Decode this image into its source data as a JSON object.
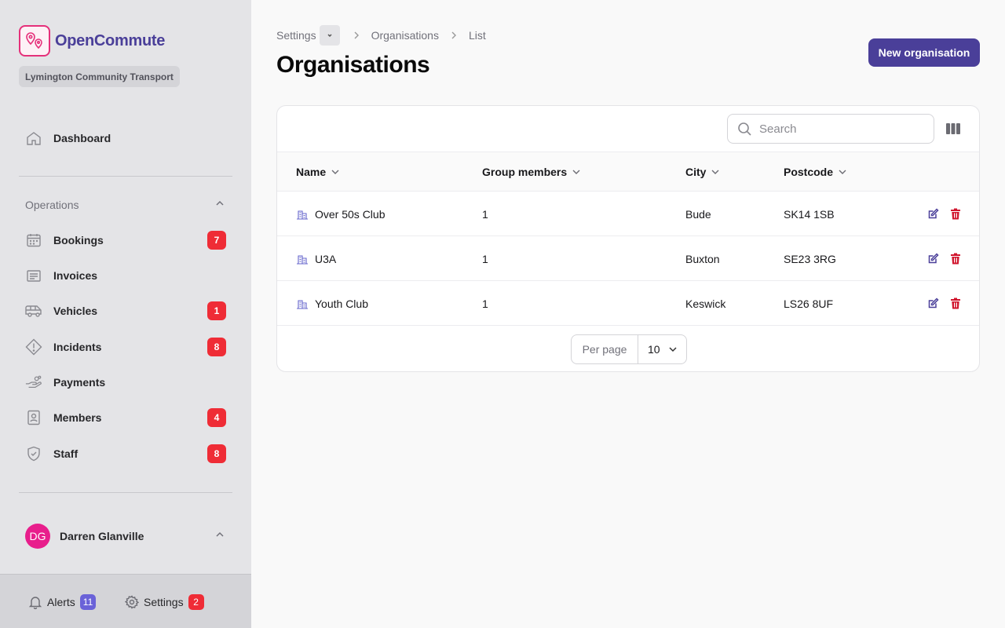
{
  "app": {
    "name": "OpenCommute",
    "organisation": "Lymington Community Transport",
    "brand_color": "#4a3f99",
    "logo_color": "#e5307a"
  },
  "sidebar": {
    "dashboard": {
      "label": "Dashboard",
      "icon": "home-icon"
    },
    "group_label": "Operations",
    "items": [
      {
        "label": "Bookings",
        "icon": "calendar-icon",
        "badge": "7"
      },
      {
        "label": "Invoices",
        "icon": "receipt-icon",
        "badge": null
      },
      {
        "label": "Vehicles",
        "icon": "van-icon",
        "badge": "1"
      },
      {
        "label": "Incidents",
        "icon": "warning-icon",
        "badge": "8"
      },
      {
        "label": "Payments",
        "icon": "hand-coins-icon",
        "badge": null
      },
      {
        "label": "Members",
        "icon": "id-badge-icon",
        "badge": "4"
      },
      {
        "label": "Staff",
        "icon": "shield-check-icon",
        "badge": "8"
      }
    ],
    "user": {
      "initials": "DG",
      "name": "Darren Glanville"
    },
    "footer": {
      "alerts_label": "Alerts",
      "alerts_count": "11",
      "settings_label": "Settings",
      "settings_count": "2"
    }
  },
  "breadcrumb": [
    "Settings",
    "Organisations",
    "List"
  ],
  "page": {
    "title": "Organisations",
    "new_button": "New organisation"
  },
  "table": {
    "search_placeholder": "Search",
    "columns": [
      "Name",
      "Group members",
      "City",
      "Postcode"
    ],
    "rows": [
      {
        "name": "Over 50s Club",
        "members": "1",
        "city": "Bude",
        "postcode": "SK14 1SB"
      },
      {
        "name": "U3A",
        "members": "1",
        "city": "Buxton",
        "postcode": "SE23 3RG"
      },
      {
        "name": "Youth Club",
        "members": "1",
        "city": "Keswick",
        "postcode": "LS26 8UF"
      }
    ],
    "per_page_label": "Per page",
    "per_page_value": "10"
  }
}
